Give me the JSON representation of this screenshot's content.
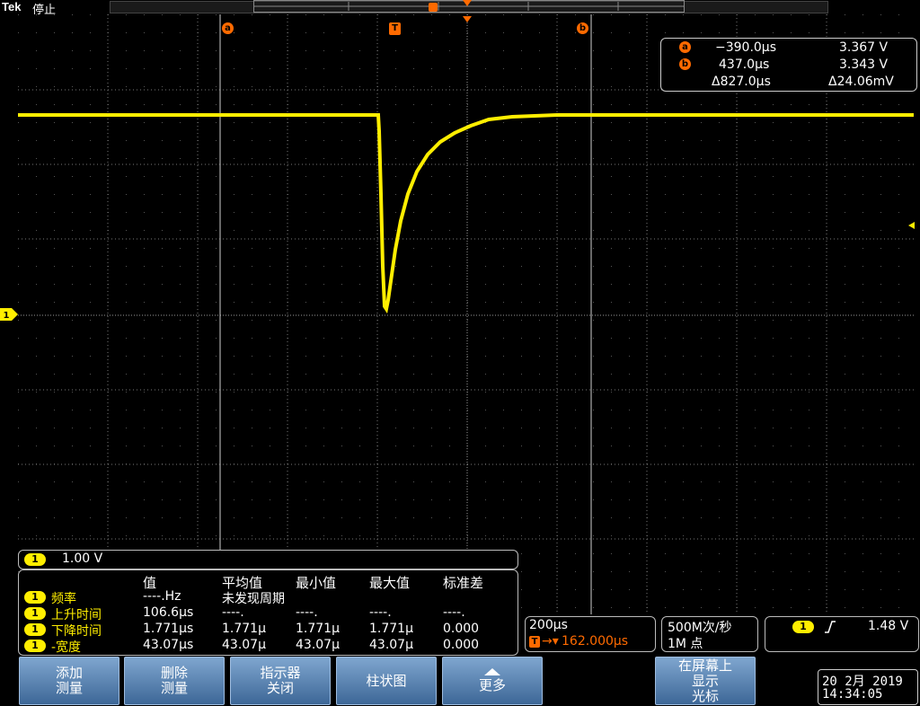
{
  "header": {
    "brand": "Tek",
    "run_state": "停止"
  },
  "markers": {
    "cursor_a": "a",
    "cursor_b": "b",
    "trigger": "T"
  },
  "cursor_readout": {
    "a": {
      "label": "a",
      "time": "−390.0µs",
      "voltage": "3.367 V"
    },
    "b": {
      "label": "b",
      "time": "437.0µs",
      "voltage": "3.343 V"
    },
    "delta": {
      "time": "Δ827.0µs",
      "voltage": "Δ24.06mV"
    }
  },
  "channel": {
    "badge": "1",
    "scale": "1.00 V"
  },
  "measurements": {
    "headers": [
      "值",
      "平均值",
      "最小值",
      "最大值",
      "标准差"
    ],
    "rows": [
      {
        "badge": "1",
        "name": "频率",
        "value": "----.Hz",
        "mean": "未发现周期",
        "min": "",
        "max": "",
        "std": ""
      },
      {
        "badge": "1",
        "name": "上升时间",
        "value": "106.6µs",
        "mean": "----.",
        "min": "----.",
        "max": "----.",
        "std": "----."
      },
      {
        "badge": "1",
        "name": "下降时间",
        "value": "1.771µs",
        "mean": "1.771µ",
        "min": "1.771µ",
        "max": "1.771µ",
        "std": "0.000"
      },
      {
        "badge": "1",
        "name": "-宽度",
        "value": "43.07µs",
        "mean": "43.07µ",
        "min": "43.07µ",
        "max": "43.07µ",
        "std": "0.000"
      }
    ]
  },
  "timebase": {
    "scale": "200µs",
    "position": "162.000µs",
    "trigger_badge": "T"
  },
  "acquisition": {
    "rate": "500M次/秒",
    "length": "1M 点"
  },
  "trigger_info": {
    "badge": "1",
    "slope": "rising",
    "level": "1.48 V"
  },
  "softkeys": [
    {
      "lines": [
        "添加",
        "测量"
      ]
    },
    {
      "lines": [
        "删除",
        "测量"
      ]
    },
    {
      "lines": [
        "指示器",
        "关闭"
      ]
    },
    {
      "lines": [
        "柱状图"
      ]
    },
    {
      "lines": [
        "更多"
      ]
    },
    {
      "lines": [
        "在屏幕上",
        "显示",
        "光标"
      ]
    }
  ],
  "datetime": {
    "date": "20 2月 2019",
    "time": "14:34:05"
  },
  "colors": {
    "trace": "#ffee00",
    "cursor_marker": "#ff6a00",
    "softkey": "#5b85b4"
  }
}
